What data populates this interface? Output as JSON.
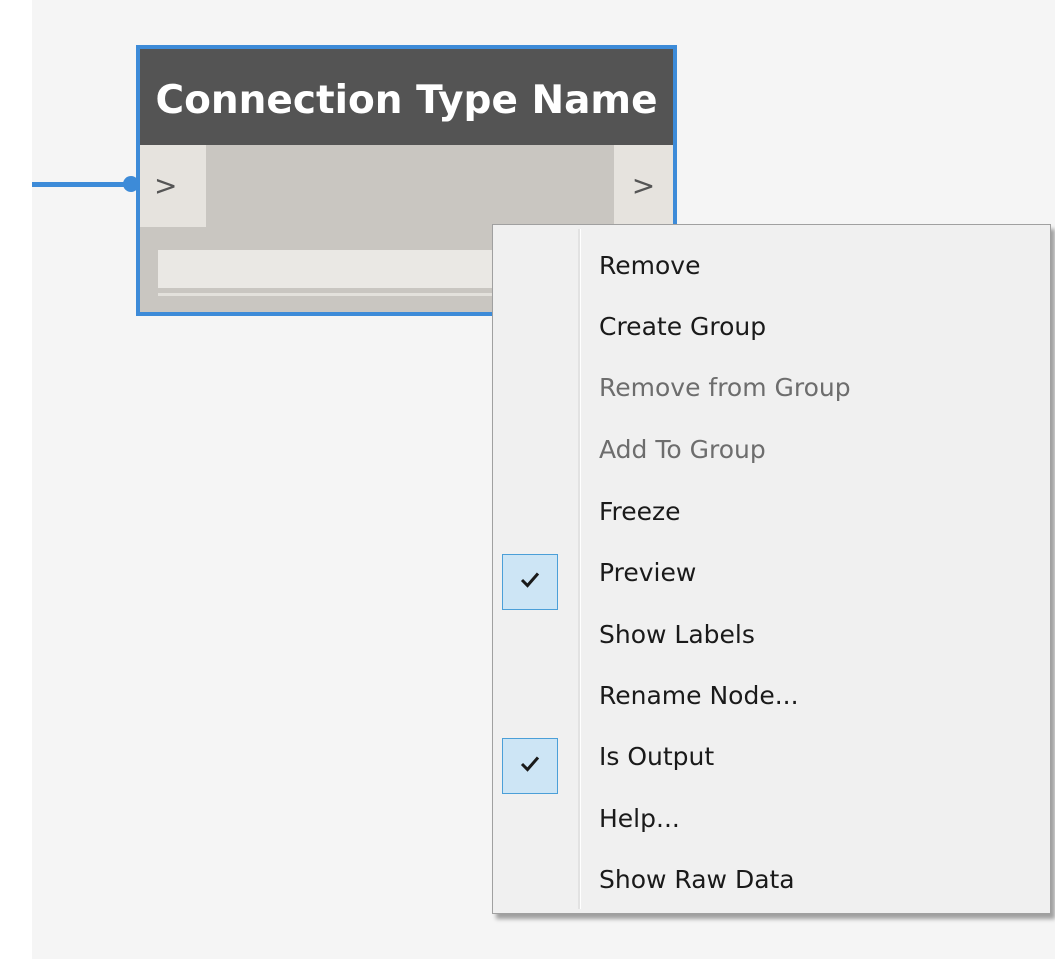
{
  "node": {
    "title": "Connection Type Name",
    "input_port": ">",
    "output_port": ">",
    "accent_color": "#3d8bd8"
  },
  "context_menu": {
    "items": [
      {
        "label": "Remove",
        "enabled": true,
        "checked": false
      },
      {
        "label": "Create Group",
        "enabled": true,
        "checked": false
      },
      {
        "label": "Remove from Group",
        "enabled": false,
        "checked": false
      },
      {
        "label": "Add To Group",
        "enabled": false,
        "checked": false
      },
      {
        "label": "Freeze",
        "enabled": true,
        "checked": false
      },
      {
        "label": "Preview",
        "enabled": true,
        "checked": true
      },
      {
        "label": "Show Labels",
        "enabled": true,
        "checked": false
      },
      {
        "label": "Rename Node...",
        "enabled": true,
        "checked": false
      },
      {
        "label": "Is Output",
        "enabled": true,
        "checked": true
      },
      {
        "label": "Help...",
        "enabled": true,
        "checked": false
      },
      {
        "label": "Show Raw Data",
        "enabled": true,
        "checked": false
      }
    ],
    "check_icon": "checkmark-icon"
  }
}
